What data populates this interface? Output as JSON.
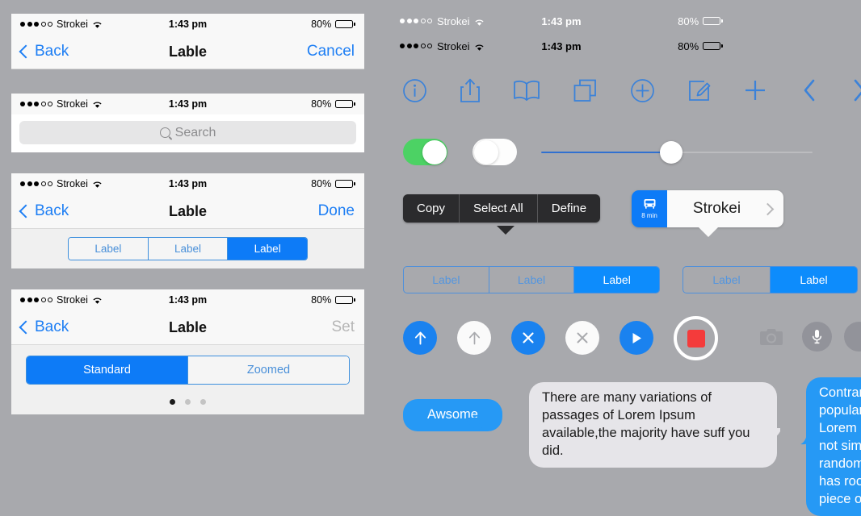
{
  "meta": {
    "background_color": "#a8a9ad",
    "accent_blue": "#0d7bf7",
    "toggle_green": "#4cd264",
    "record_red": "#f43b3b"
  },
  "status_bar": {
    "carrier": "Strokei",
    "time": "1:43 pm",
    "battery_percent": "80%",
    "signal_filled": 3,
    "signal_empty": 2,
    "wifi_icon": "wifi-icon",
    "battery_icon": "battery-icon"
  },
  "panels": [
    {
      "id": "panel-navbar-cancel",
      "nav": {
        "back_label": "Back",
        "title": "Lable",
        "right_label": "Cancel",
        "right_disabled": false
      }
    },
    {
      "id": "panel-search",
      "search": {
        "placeholder": "Search",
        "icon": "search-icon"
      }
    },
    {
      "id": "panel-segmented-three",
      "nav": {
        "back_label": "Back",
        "title": "Lable",
        "right_label": "Done",
        "right_disabled": false
      },
      "segmented": {
        "options": [
          "Label",
          "Label",
          "Label"
        ],
        "selected_index": 2
      }
    },
    {
      "id": "panel-display-zoom",
      "nav": {
        "back_label": "Back",
        "title": "Lable",
        "right_label": "Set",
        "right_disabled": true
      },
      "segmented": {
        "options": [
          "Standard",
          "Zoomed"
        ],
        "selected_index": 0
      },
      "page_dots": {
        "count": 3,
        "active_index": 0
      }
    }
  ],
  "right": {
    "status_bars": [
      {
        "style": "white",
        "carrier": "Strokei",
        "time": "1:43 pm",
        "battery_percent": "80%"
      },
      {
        "style": "black",
        "carrier": "Strokei",
        "time": "1:43 pm",
        "battery_percent": "80%"
      }
    ],
    "icon_row": [
      {
        "name": "info-circle-icon"
      },
      {
        "name": "share-upload-icon"
      },
      {
        "name": "book-icon"
      },
      {
        "name": "pages-copy-icon"
      },
      {
        "name": "plus-circle-icon"
      },
      {
        "name": "compose-icon"
      },
      {
        "name": "plus-icon"
      },
      {
        "name": "chevron-left-icon"
      },
      {
        "name": "chevron-right-icon"
      }
    ],
    "toggles": [
      {
        "name": "toggle-on",
        "state": "on"
      },
      {
        "name": "toggle-off",
        "state": "off"
      }
    ],
    "slider": {
      "value_percent": 48,
      "name": "volume-slider"
    },
    "context_menu": {
      "items": [
        "Copy",
        "Select All",
        "Define"
      ]
    },
    "banner": {
      "badge_minutes": "8 min",
      "transit_icon": "bus-icon",
      "title": "Strokei",
      "chevron": "chevron-right-icon"
    },
    "segmented_ghost_a": {
      "options": [
        "Label",
        "Label",
        "Label"
      ],
      "selected_index": 2
    },
    "segmented_ghost_b": {
      "options": [
        "Label",
        "Label"
      ],
      "selected_index": 1
    },
    "circle_buttons": [
      {
        "name": "arrow-up-blue-button",
        "icon": "arrow-up-icon",
        "style": "blue"
      },
      {
        "name": "arrow-up-white-button",
        "icon": "arrow-up-icon",
        "style": "white"
      },
      {
        "name": "close-blue-button",
        "icon": "close-icon",
        "style": "blue"
      },
      {
        "name": "close-white-button",
        "icon": "close-icon",
        "style": "white"
      },
      {
        "name": "play-blue-button",
        "icon": "play-icon",
        "style": "blue"
      },
      {
        "name": "stop-record-button",
        "icon": "record-stop-icon",
        "style": "ring"
      }
    ],
    "media_icons": [
      {
        "name": "camera-icon"
      },
      {
        "name": "microphone-icon"
      }
    ],
    "messages": [
      {
        "name": "message-bubble-outgoing",
        "style": "blue",
        "text": "Awsome"
      },
      {
        "name": "message-bubble-incoming",
        "style": "gray",
        "text": "There are many variations of passages of Lorem Ipsum available,the majority have suff you did."
      },
      {
        "name": "message-bubble-outgoing-cut",
        "style": "blue",
        "text": "Contrary to popular belief, Lorem Ipsum is not simply random text. It has roots in a piece of classical."
      }
    ]
  }
}
